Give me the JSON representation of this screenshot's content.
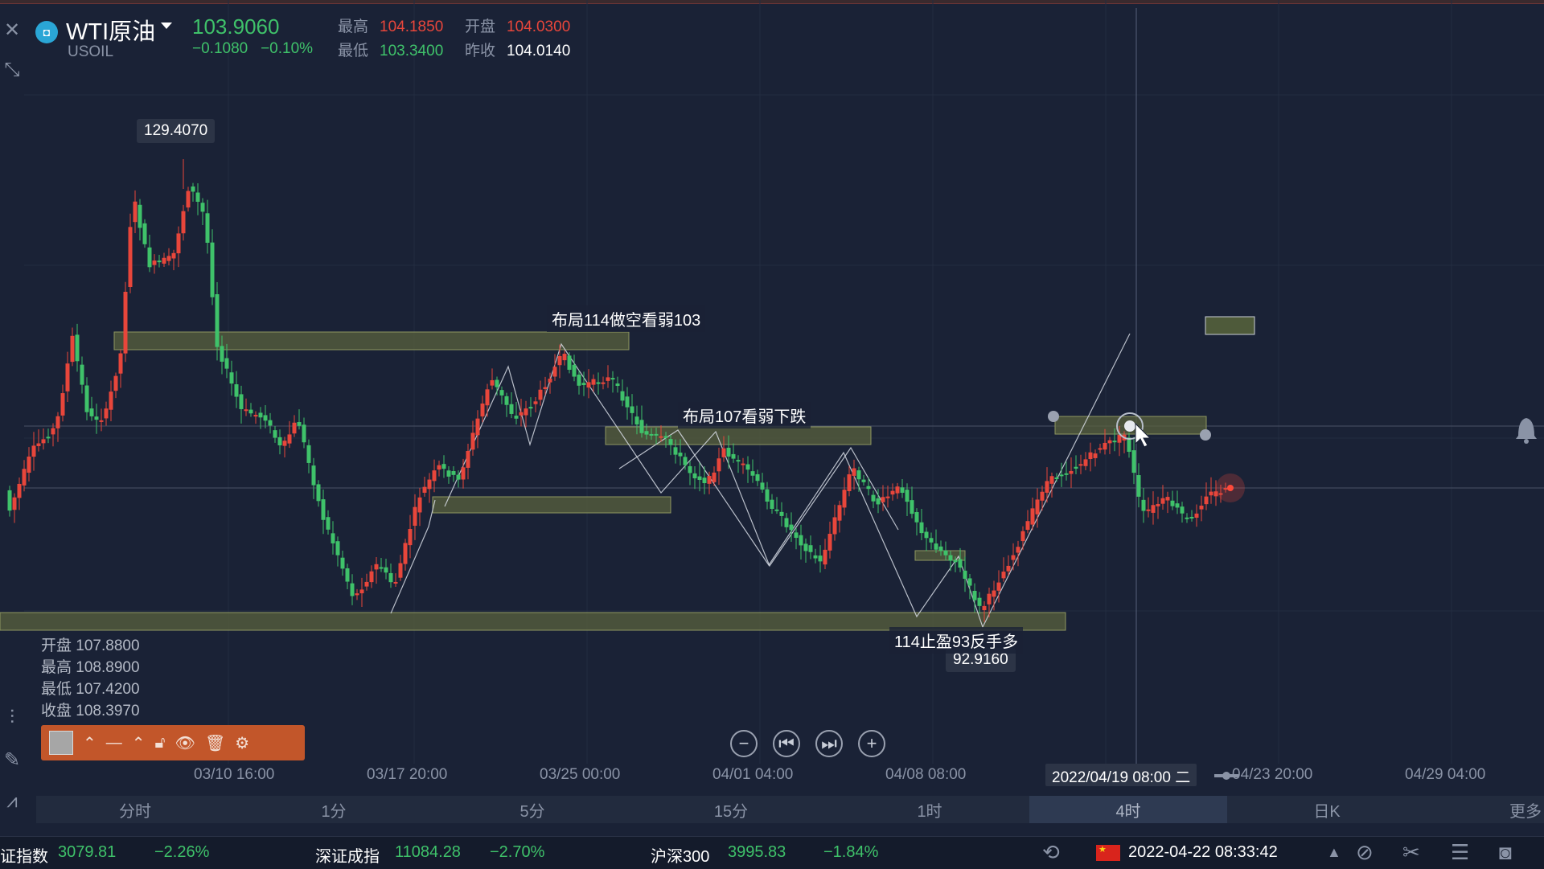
{
  "symbol": {
    "name": "WTI原油",
    "code": "USOIL",
    "price": "103.9060",
    "change": "−0.1080",
    "change_pct": "−0.10%"
  },
  "ohlc": [
    {
      "label": "最高",
      "value": "104.1850",
      "color": "#e8463b"
    },
    {
      "label": "开盘",
      "value": "104.0300",
      "color": "#e8463b"
    },
    {
      "label": "最低",
      "value": "103.3400",
      "color": "#3fc26a"
    },
    {
      "label": "昨收",
      "value": "104.0140",
      "color": "#ffffff"
    }
  ],
  "tags": {
    "high": "129.4070",
    "low": "92.9160"
  },
  "annotations": [
    "布局114做空看弱103",
    "布局107看弱下跌",
    "114止盈93反手多"
  ],
  "candle_info": [
    {
      "label": "开盘",
      "value": "107.8800"
    },
    {
      "label": "最高",
      "value": "108.8900"
    },
    {
      "label": "最低",
      "value": "107.4200"
    },
    {
      "label": "收盘",
      "value": "108.3970"
    }
  ],
  "toolbar": {
    "icons": [
      "color-swatch-icon",
      "chevron-up-icon",
      "line-style-icon",
      "chevron-up-icon",
      "lock-icon",
      "eye-icon",
      "trash-icon",
      "settings-icon"
    ]
  },
  "xaxis": [
    "03/10 16:00",
    "03/17 20:00",
    "03/25 00:00",
    "04/01 04:00",
    "04/08 08:00",
    "04/23 20:00",
    "04/29 04:00"
  ],
  "crosshair_time": "2022/04/19 08:00 二",
  "periods": [
    {
      "label": "分时",
      "active": false
    },
    {
      "label": "1分",
      "active": false
    },
    {
      "label": "5分",
      "active": false
    },
    {
      "label": "15分",
      "active": false
    },
    {
      "label": "1时",
      "active": false
    },
    {
      "label": "4时",
      "active": true
    },
    {
      "label": "日K",
      "active": false
    },
    {
      "label": "更多",
      "active": false
    }
  ],
  "indices": [
    {
      "name": "证指数",
      "value": "3079.81",
      "pct": "−2.26%"
    },
    {
      "name": "深证成指",
      "value": "11084.28",
      "pct": "−2.70%"
    },
    {
      "name": "沪深300",
      "value": "3995.83",
      "pct": "−1.84%"
    }
  ],
  "datetime": "2022-04-22 08:33:42",
  "colors": {
    "up": "#e8463b",
    "down": "#3fc26a",
    "zone": "#59623e",
    "bg": "#1a2236",
    "accent": "#c2562a"
  }
}
